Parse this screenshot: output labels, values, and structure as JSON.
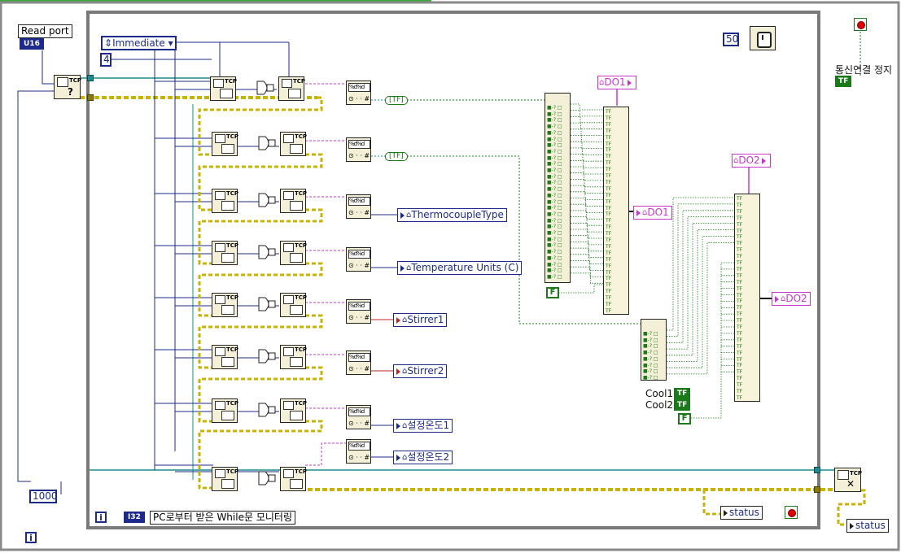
{
  "read_port_label": "Read port",
  "read_port_type": "U16",
  "mode_ring": "Immediate",
  "const_4": "4",
  "const_50": "50",
  "const_1000": "1000",
  "stop_label": "통신연결 정지",
  "tf_label": "TF",
  "indicators": {
    "do1_top": "DO1",
    "do1_mid": "DO1",
    "do2_top": "DO2",
    "do2_mid": "DO2",
    "thermocouple": "ThermocoupleType",
    "temp_units": "Temperature Units (C)",
    "stirrer1": "Stirrer1",
    "stirrer2": "Stirrer2",
    "setpoint1": "설정온도1",
    "setpoint2": "설정온도2",
    "status_inner": "status",
    "status_outer": "status"
  },
  "cool1": "Cool1",
  "cool2": "Cool2",
  "false_const": "F",
  "iteration_i": "i",
  "i32_type": "I32",
  "monitor_label": "PC로부터 받은 While문 모니터링",
  "colors": {
    "wire_teal": "#1e8c8c",
    "wire_blue": "#1d2a8a",
    "wire_pink": "#c838c8",
    "wire_green": "#1a7a1a",
    "error_yellow": "#c8b400",
    "loop_gray": "#7a7a7a"
  }
}
